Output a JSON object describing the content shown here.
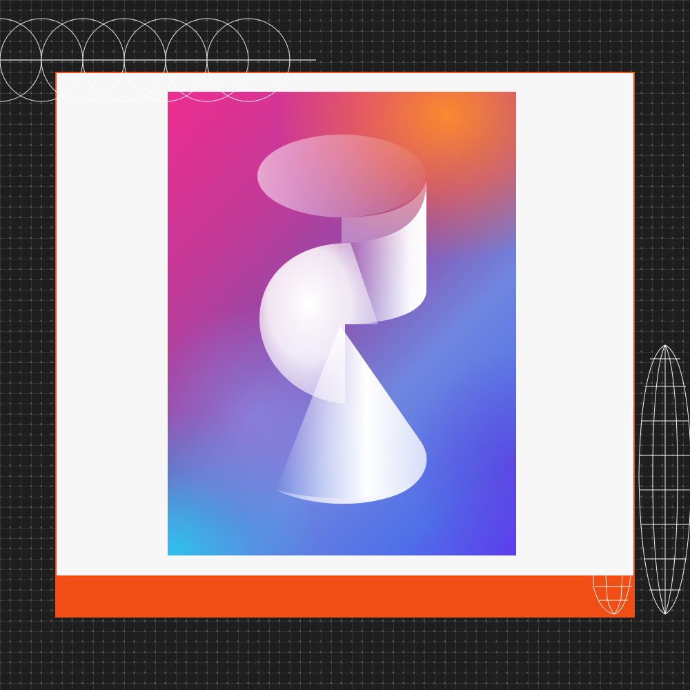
{
  "colors": {
    "background": "#1e1e1e",
    "frame_accent": "#f04e14",
    "frame_fill": "#f7f7f7",
    "line_art": "#ffffff"
  },
  "artwork": {
    "shapes": [
      "cylinder",
      "half-sphere",
      "cone"
    ],
    "decorations": [
      "overlapping-circles-line-art",
      "wireframe-capsule-large",
      "wireframe-capsule-small"
    ]
  }
}
